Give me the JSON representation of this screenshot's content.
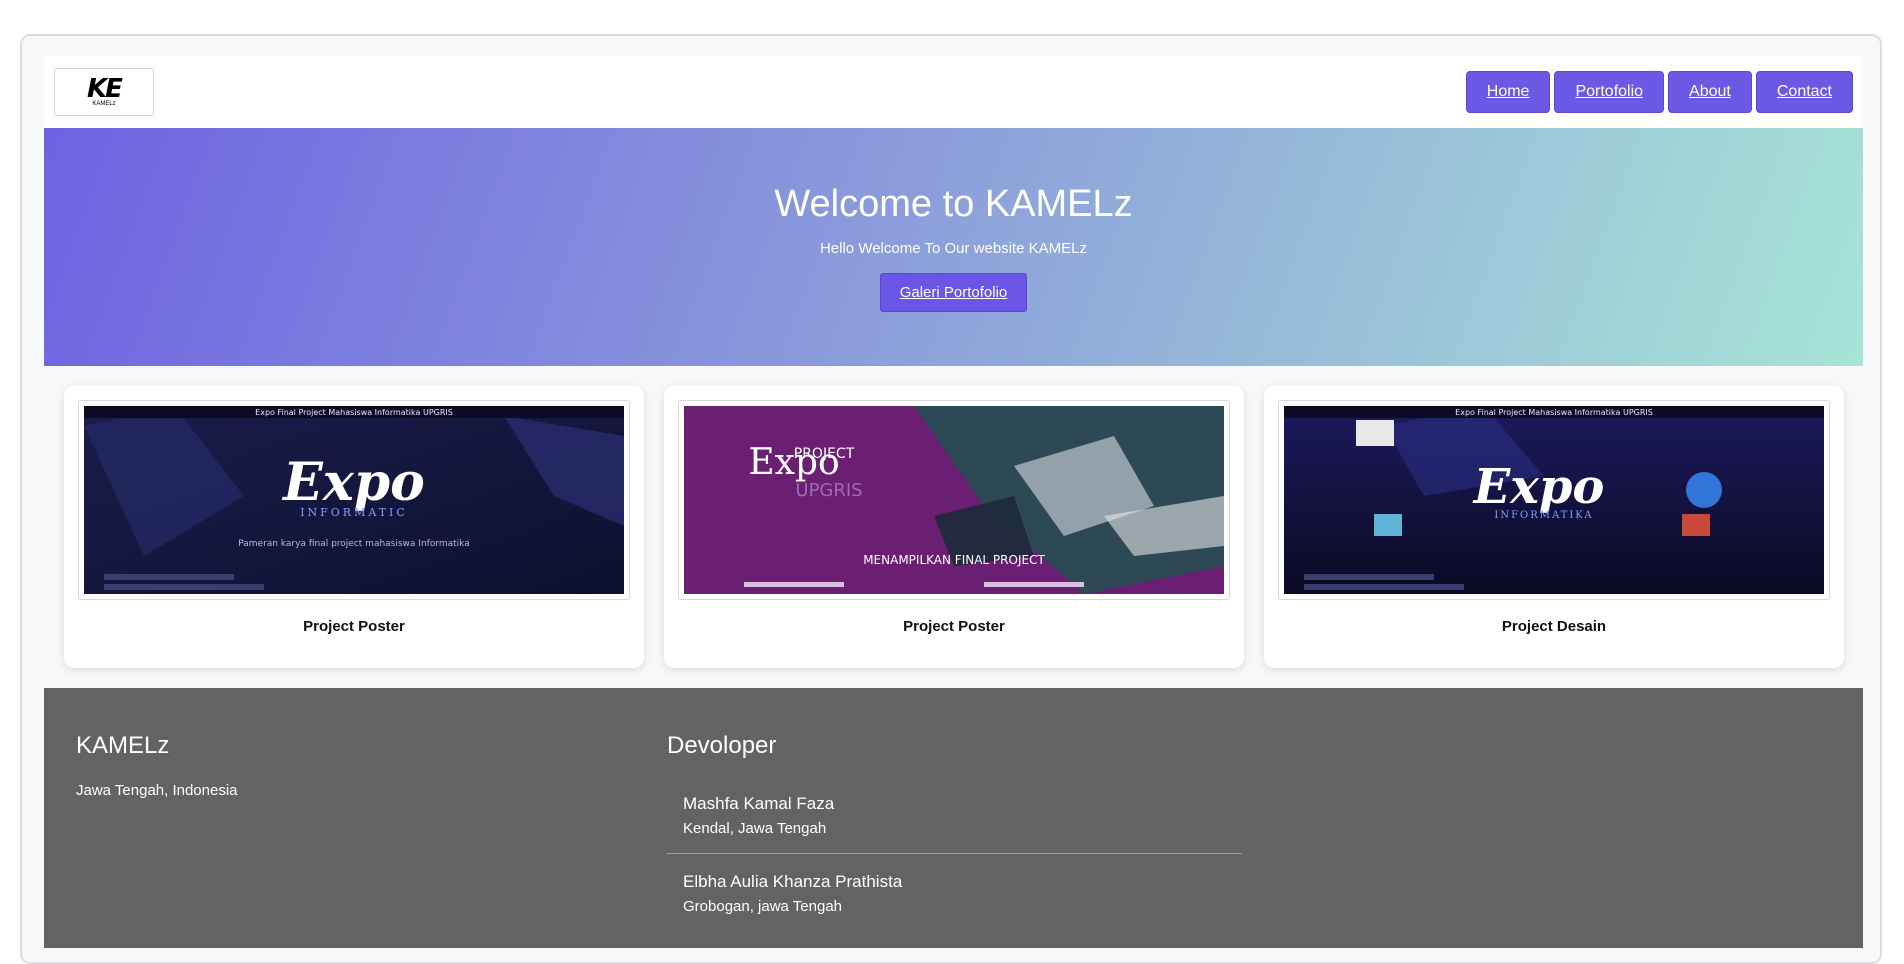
{
  "header": {
    "logo": {
      "mark": "KE",
      "text": "KAMELz"
    },
    "nav": [
      {
        "label": "Home"
      },
      {
        "label": "Portofolio"
      },
      {
        "label": "About"
      },
      {
        "label": "Contact"
      }
    ]
  },
  "hero": {
    "title": "Welcome to KAMELz",
    "subtitle": "Hello Welcome To Our website KAMELz",
    "button_label": "Galeri Portofolio",
    "colors": {
      "start": "#6e62e2",
      "end": "#a7e4d6"
    }
  },
  "cards": [
    {
      "title": "Project Poster",
      "image": {
        "header": "Expo Final Project Mahasiswa Informatika UPGRIS",
        "big": "Expo",
        "sub": "INFORMATIC",
        "desc": "Pameran karya final project mahasiswa Informatika"
      }
    },
    {
      "title": "Project Poster",
      "image": {
        "small": "PROJECT",
        "big": "Expo",
        "sub": "UPGRIS",
        "desc": "MENAMPILKAN FINAL PROJECT"
      }
    },
    {
      "title": "Project Desain",
      "image": {
        "header": "Expo Final Project Mahasiswa Informatika UPGRIS",
        "big": "Expo",
        "sub": "INFORMATIKA"
      }
    }
  ],
  "footer": {
    "brand": "KAMELz",
    "location": "Jawa Tengah, Indonesia",
    "dev_title": "Devoloper",
    "developers": [
      {
        "name": "Mashfa Kamal Faza",
        "location": "Kendal, Jawa Tengah"
      },
      {
        "name": "Elbha Aulia Khanza Prathista",
        "location": "Grobogan, jawa Tengah"
      }
    ]
  },
  "colors": {
    "accent": "#6b58e4",
    "footer_bg": "#636363"
  }
}
